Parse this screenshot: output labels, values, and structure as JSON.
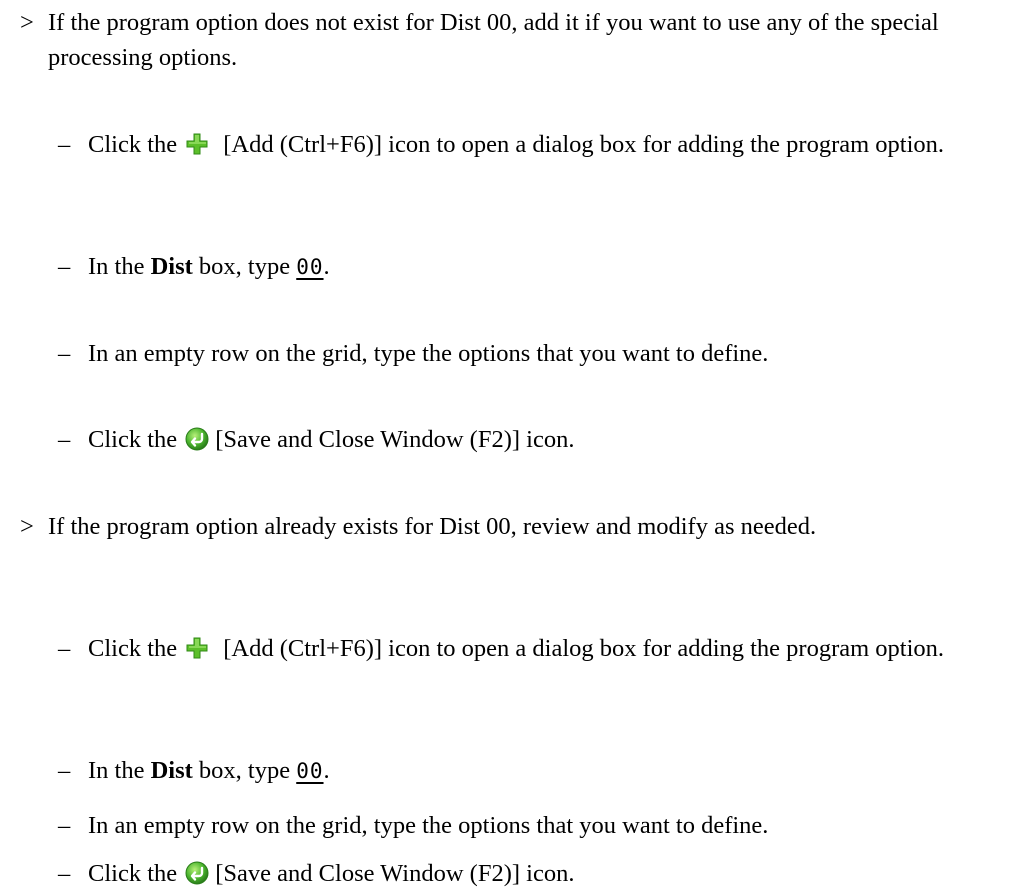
{
  "section1": {
    "marker": ">",
    "text": "If the program option does not exist for Dist 00, add it if you want to use any of the special processing options.",
    "steps": {
      "add": {
        "marker": "–",
        "pre": "Click the",
        "icon": "green-plus-icon",
        "text": "[Add (Ctrl+F6)] icon to open a dialog box for adding the program option."
      },
      "dist": {
        "marker": "–",
        "pre": "In the",
        "bold": "Dist",
        "mid": "box, type",
        "code": "00",
        "post": "."
      },
      "grid": {
        "marker": "–",
        "text": "In an empty row on the grid, type the options that you want to define."
      },
      "save": {
        "marker": "–",
        "pre": "Click the",
        "icon": "save-close-icon",
        "text": "[Save and Close Window (F2)] icon."
      }
    }
  },
  "section2": {
    "marker": ">",
    "text": "If the program option already exists for Dist 00, review and modify as needed.",
    "steps": {
      "add": {
        "marker": "–",
        "pre": "Click the",
        "icon": "green-plus-icon",
        "text": "[Add (Ctrl+F6)] icon to open a dialog box for adding the program option."
      },
      "dist": {
        "marker": "–",
        "pre": "In the",
        "bold": "Dist",
        "mid": "box, type",
        "code": "00",
        "post": "."
      },
      "grid": {
        "marker": "–",
        "text": "In an empty row on the grid, type the options that you want to define."
      },
      "save": {
        "marker": "–",
        "pre": "Click the",
        "icon": "save-close-icon",
        "text": "[Save and Close Window (F2)] icon."
      }
    }
  },
  "colors": {
    "plus_icon_green": "#5cbf2a",
    "save_icon_green": "#3aa83a",
    "text": "#000000"
  }
}
